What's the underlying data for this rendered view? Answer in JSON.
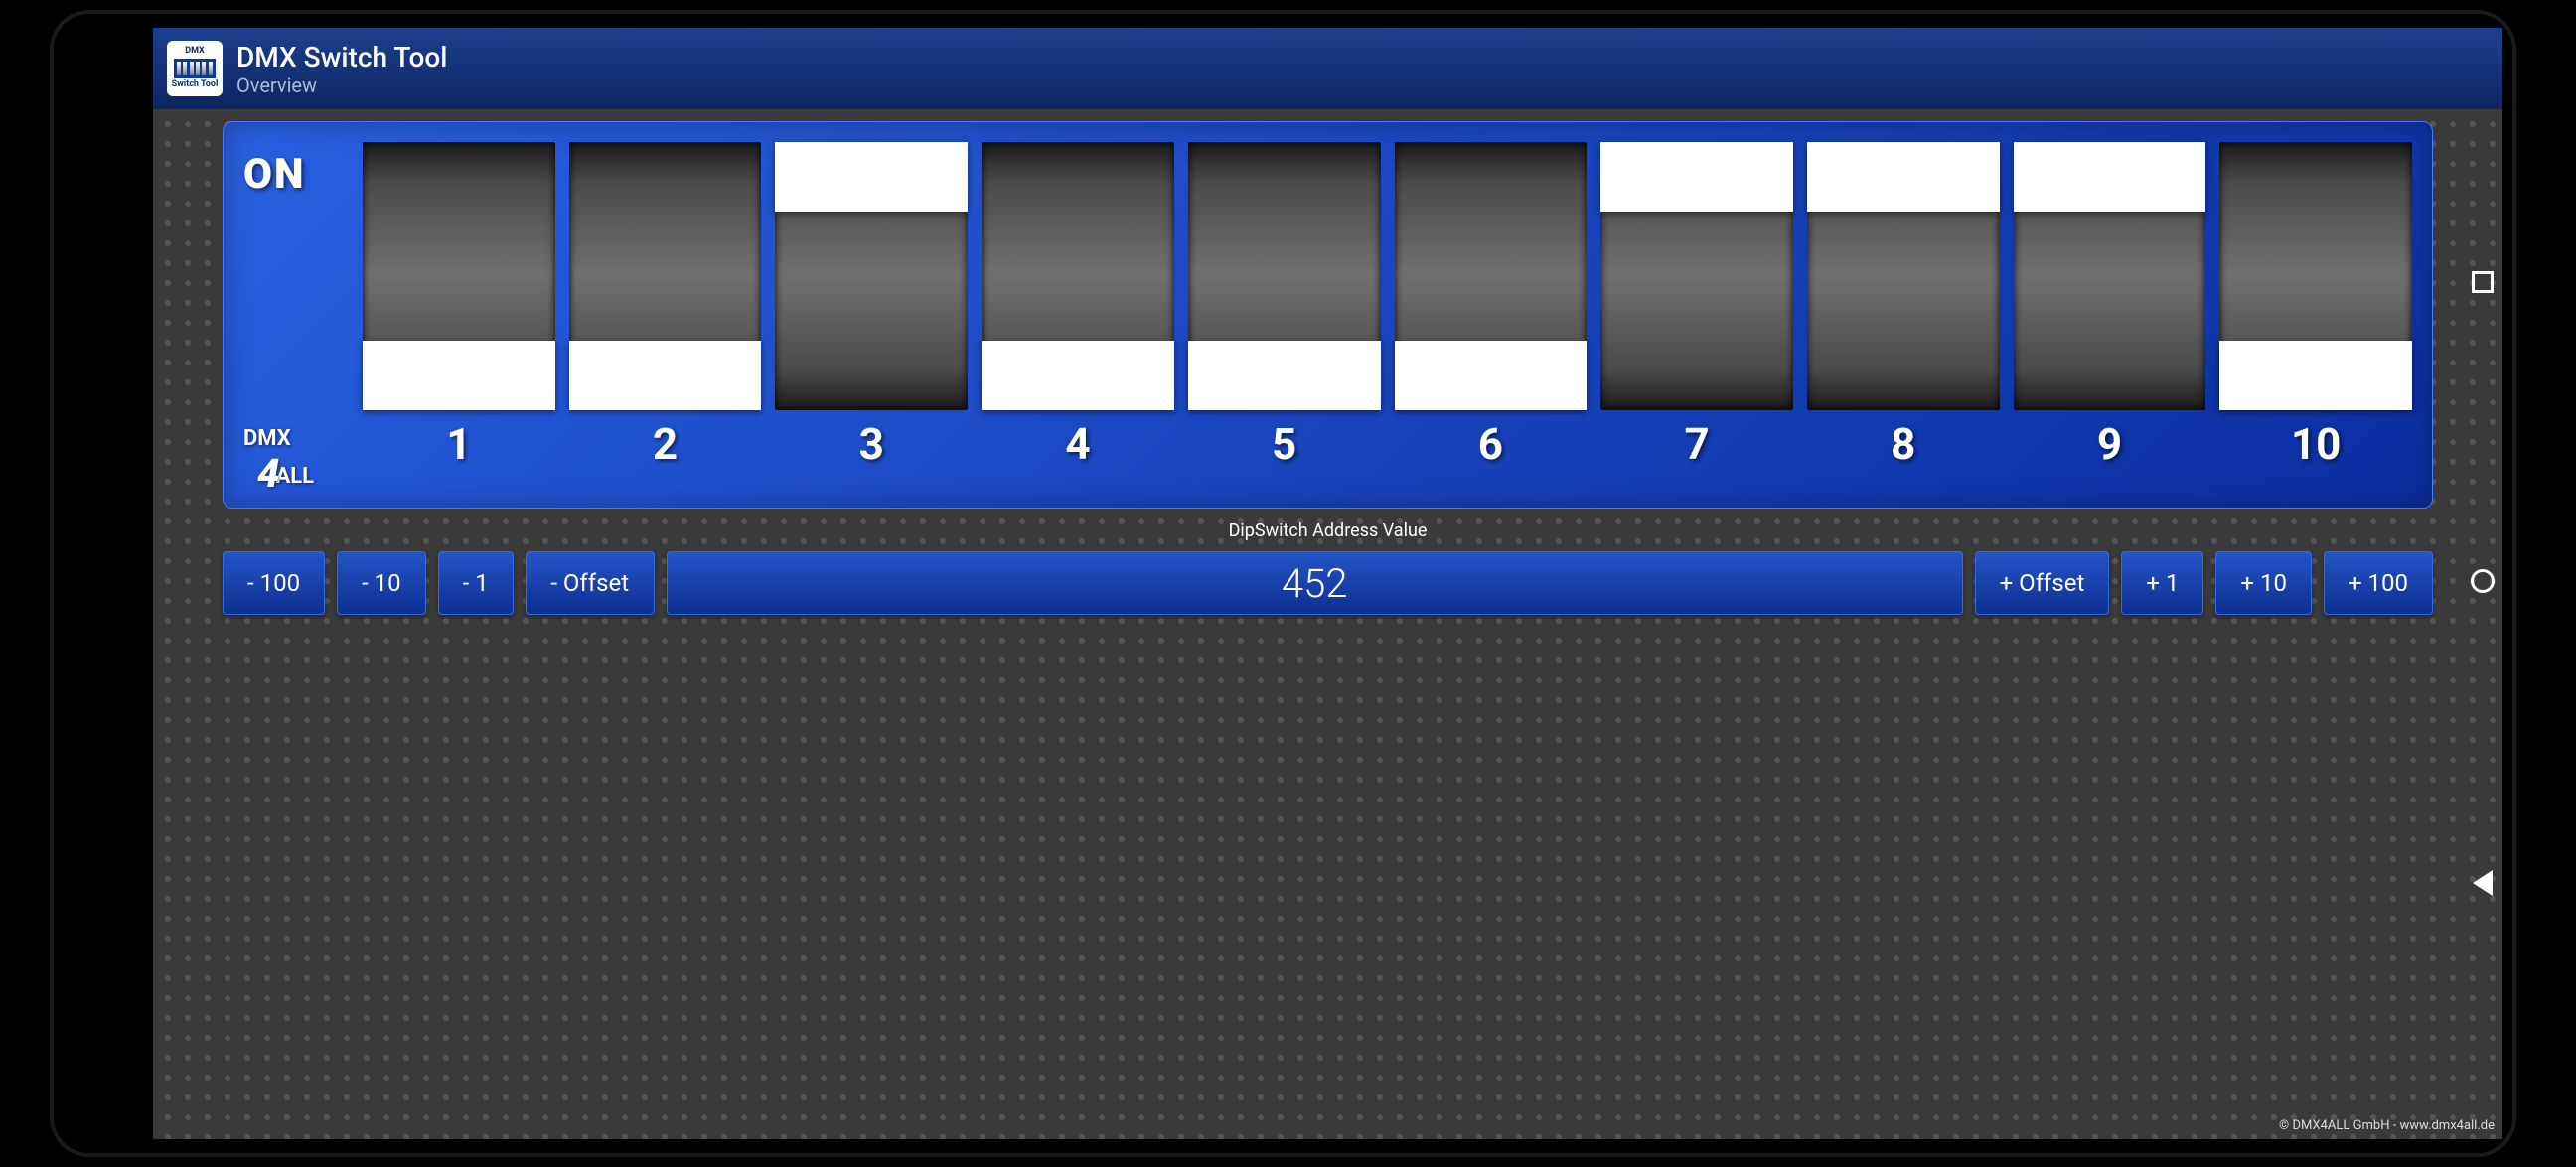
{
  "header": {
    "app_name": "DMX Switch Tool",
    "subtitle": "Overview",
    "icon_top": "DMX",
    "icon_bottom": "Switch Tool"
  },
  "dip": {
    "on_label": "ON",
    "brand_top": "DMX",
    "brand_mid": "4",
    "brand_bot": "ALL",
    "switches": [
      {
        "num": "1",
        "on": false
      },
      {
        "num": "2",
        "on": false
      },
      {
        "num": "3",
        "on": true
      },
      {
        "num": "4",
        "on": false
      },
      {
        "num": "5",
        "on": false
      },
      {
        "num": "6",
        "on": false
      },
      {
        "num": "7",
        "on": true
      },
      {
        "num": "8",
        "on": true
      },
      {
        "num": "9",
        "on": true
      },
      {
        "num": "10",
        "on": false
      }
    ]
  },
  "section_label": "DipSwitch Address Value",
  "controls": {
    "minus100": "- 100",
    "minus10": "- 10",
    "minus1": "- 1",
    "minusOffset": "- Offset",
    "value": "452",
    "plusOffset": "+ Offset",
    "plus1": "+ 1",
    "plus10": "+ 10",
    "plus100": "+ 100"
  },
  "footer": "© DMX4ALL GmbH - www.dmx4all.de"
}
